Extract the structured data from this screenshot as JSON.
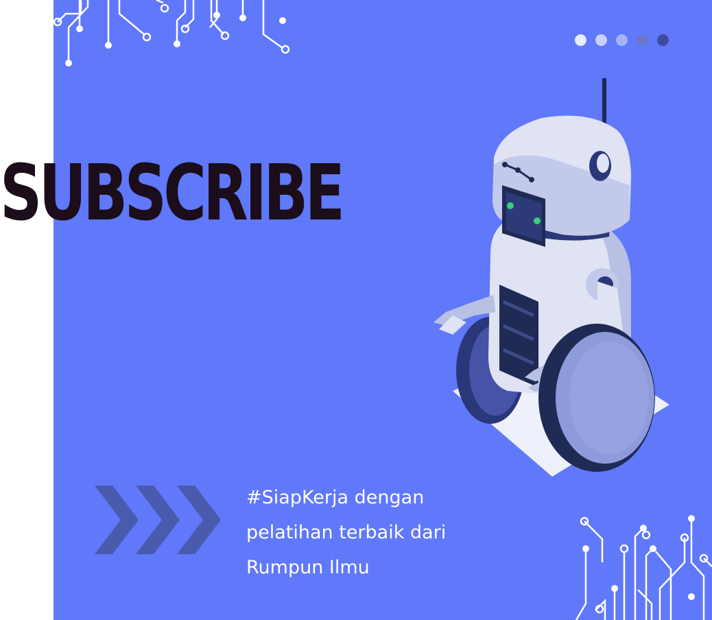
{
  "title": "SUBSCRIBE",
  "tagline": {
    "line1": "#SiapKerja dengan",
    "line2": "pelatihan terbaik dari",
    "line3": "Rumpun Ilmu"
  },
  "colors": {
    "background": "#6078fa",
    "title_text": "#1b0d1a",
    "tagline_text": "#ffffff",
    "chevrons": "#4a5aad",
    "circuit_lines": "#ffffff"
  },
  "pagination_dots": [
    {
      "color": "#e8ecff"
    },
    {
      "color": "#c8d0fb"
    },
    {
      "color": "#a6b2f6"
    },
    {
      "color": "#6a76c7"
    },
    {
      "color": "#3e4a9c"
    }
  ],
  "icons": [
    "circuit-decoration-icon",
    "robot-illustration",
    "chevron-arrows-icon"
  ]
}
